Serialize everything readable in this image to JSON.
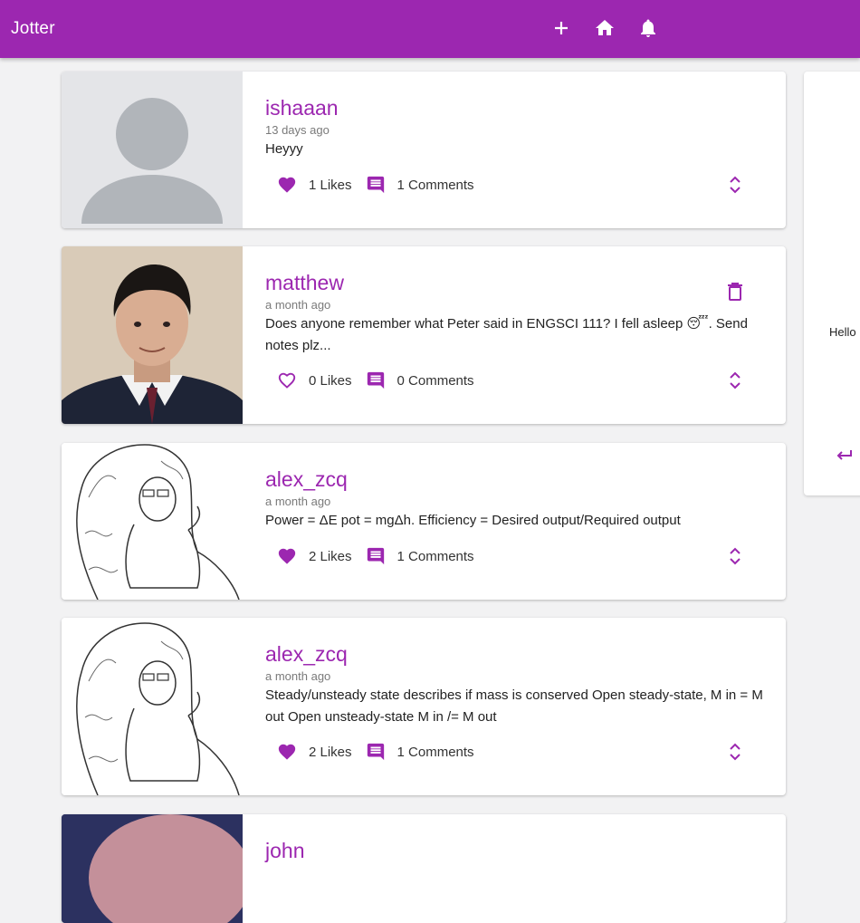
{
  "app": {
    "title": "Jotter"
  },
  "colors": {
    "primary": "#9c27b0",
    "heart": "#9c27b0"
  },
  "nav": {
    "add": {
      "icon": "plus-icon"
    },
    "home": {
      "icon": "home-icon"
    },
    "notifications": {
      "icon": "bell-icon"
    }
  },
  "posts": [
    {
      "user": "ishaaan",
      "time": "13 days ago",
      "text": "Heyyy",
      "likes": "1 Likes",
      "comments": "1 Comments",
      "liked": true,
      "avatar": "default-avatar"
    },
    {
      "user": "matthew",
      "time": "a month ago",
      "text": "Does anyone remember what Peter said in ENGSCI 111? I fell asleep 😴. Send notes plz...",
      "likes": "0 Likes",
      "comments": "0 Comments",
      "liked": false,
      "avatar": "photo-avatar",
      "deletable": true
    },
    {
      "user": "alex_zcq",
      "time": "a month ago",
      "text": "Power = ΔE pot = mgΔh. Efficiency = Desired output/Required output",
      "likes": "2 Likes",
      "comments": "1 Comments",
      "liked": true,
      "avatar": "sketch-avatar"
    },
    {
      "user": "alex_zcq",
      "time": "a month ago",
      "text": "Steady/unsteady state describes if mass is conserved Open steady-state, M in = M out Open unsteady-state M in /= M out",
      "likes": "2 Likes",
      "comments": "1 Comments",
      "liked": true,
      "avatar": "sketch-avatar"
    },
    {
      "user": "john",
      "avatar": "photo-avatar"
    }
  ],
  "side_panel": {
    "text": "Hello",
    "return_icon": "return-icon"
  }
}
